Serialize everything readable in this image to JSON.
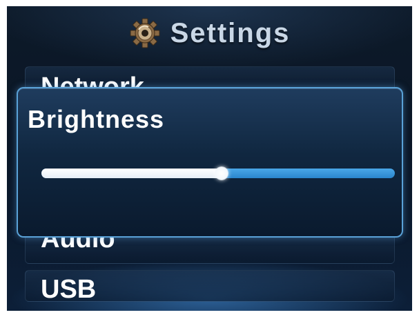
{
  "header": {
    "title": "Settings",
    "icon": "gear-icon"
  },
  "menu": {
    "items": [
      {
        "id": "network",
        "label": "Network"
      },
      {
        "id": "audio",
        "label": "Audio"
      },
      {
        "id": "usb",
        "label": "USB"
      }
    ]
  },
  "brightness_dialog": {
    "title": "Brightness",
    "level_fraction": 0.51
  },
  "colors": {
    "accent": "#3d9be0",
    "text": "#ffffff",
    "title_text": "#c9d7e6",
    "background": "#0b1828"
  }
}
